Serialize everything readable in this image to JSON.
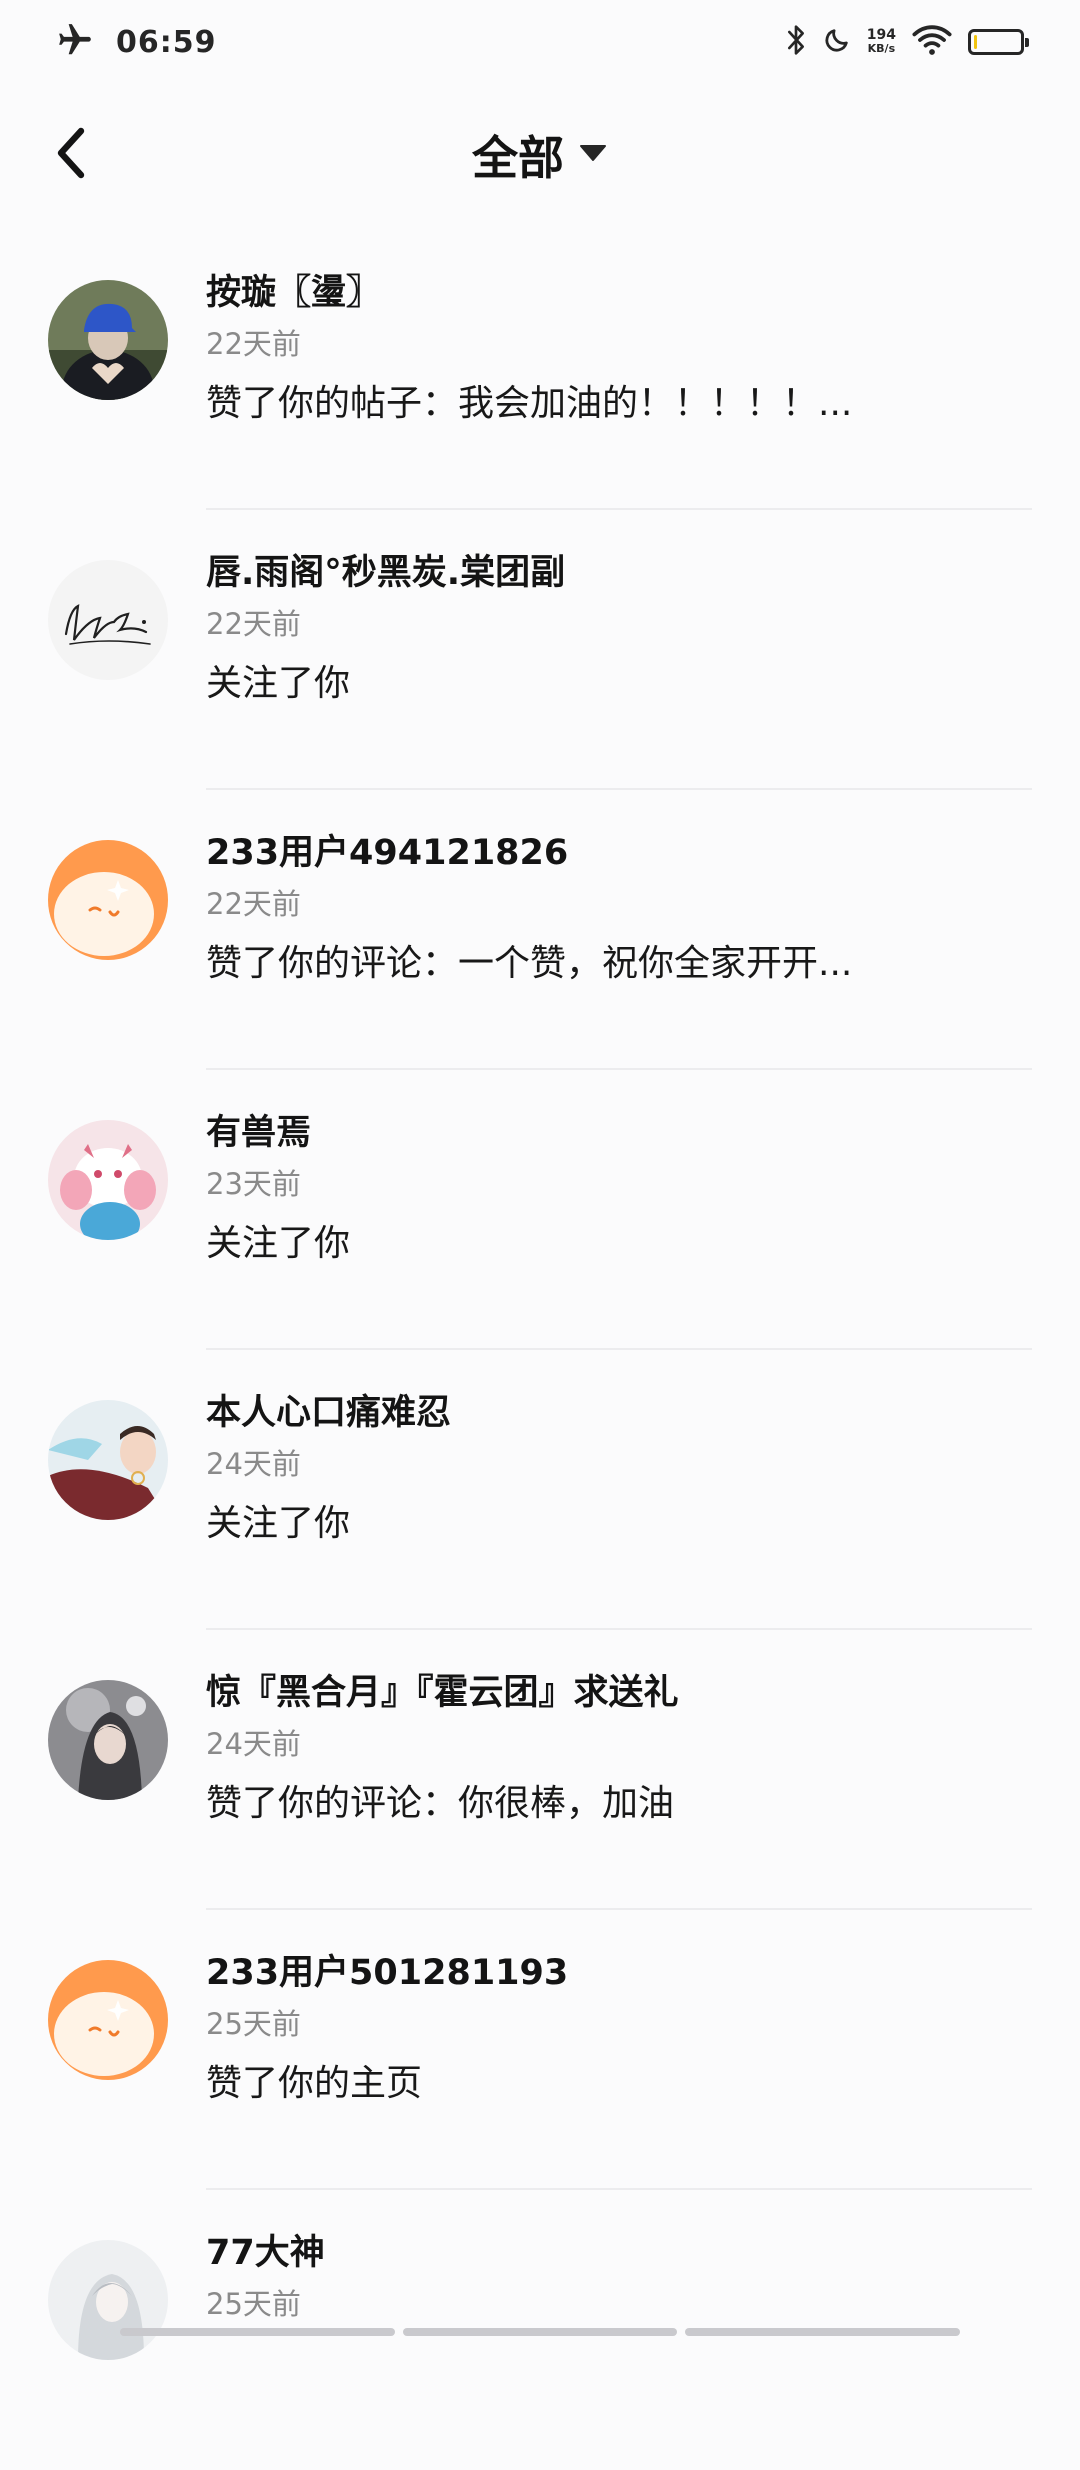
{
  "status_bar": {
    "time": "06:59",
    "network_speed_value": "194",
    "network_speed_unit": "KB/s",
    "icons": [
      "airplane-icon",
      "bluetooth-icon",
      "moon-icon",
      "wifi-icon",
      "battery-icon"
    ],
    "battery_level": 0.05
  },
  "header": {
    "title": "全部",
    "back_icon": "chevron-left-icon",
    "dropdown_icon": "triangle-down-icon"
  },
  "notifications": [
    {
      "name": "按璇〖璗〗",
      "time": "22天前",
      "action": "赞了你的帖子：我会加油的！！！！！...",
      "avatar": "photo-blue-cap"
    },
    {
      "name": "唇.雨阁°秒黑炭.棠团副",
      "time": "22天前",
      "action": "关注了你",
      "avatar": "signature"
    },
    {
      "name": "233用户494121826",
      "time": "22天前",
      "action": "赞了你的评论：一个赞，祝你全家开开...",
      "avatar": "default-orange"
    },
    {
      "name": "有兽焉",
      "time": "23天前",
      "action": "关注了你",
      "avatar": "illustration-pink"
    },
    {
      "name": "本人心口痛难忍",
      "time": "24天前",
      "action": "关注了你",
      "avatar": "photo-girl"
    },
    {
      "name": "惊『黑合月』『霍云团』求送礼",
      "time": "24天前",
      "action": "赞了你的评论：你很棒，加油",
      "avatar": "illustration-gray"
    },
    {
      "name": "233用户501281193",
      "time": "25天前",
      "action": "赞了你的主页",
      "avatar": "default-orange"
    },
    {
      "name": "77大神",
      "time": "25天前",
      "action": "",
      "avatar": "illustration-white"
    }
  ],
  "colors": {
    "background": "#fbfbfc",
    "text_primary": "#141414",
    "text_secondary": "#8a8a8a",
    "divider": "#ececee",
    "default_avatar": "#ff9a4d"
  }
}
